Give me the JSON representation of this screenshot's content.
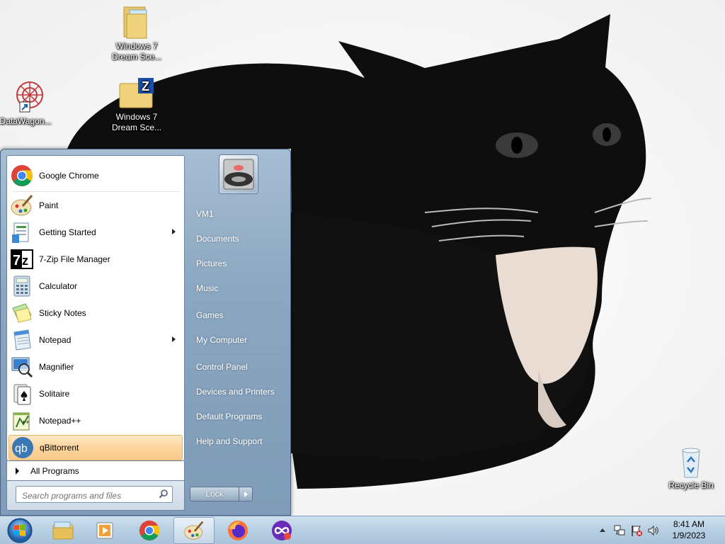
{
  "desktop": {
    "icons": [
      {
        "label_line1": "Windows 7",
        "label_line2": "Dream Sce..."
      },
      {
        "label_line1": "Windows 7",
        "label_line2": "Dream Sce..."
      },
      {
        "label_line1": "DataWagon...",
        "label_line2": ""
      },
      {
        "label_line1": "Recycle Bin",
        "label_line2": ""
      }
    ]
  },
  "start_menu": {
    "pinned": [
      {
        "label": "Google Chrome",
        "icon": "chrome-icon"
      }
    ],
    "programs": [
      {
        "label": "Paint",
        "icon": "paint-icon",
        "submenu": false
      },
      {
        "label": "Getting Started",
        "icon": "getting-started-icon",
        "submenu": true
      },
      {
        "label": "7-Zip File Manager",
        "icon": "7zip-icon",
        "submenu": false
      },
      {
        "label": "Calculator",
        "icon": "calculator-icon",
        "submenu": false
      },
      {
        "label": "Sticky Notes",
        "icon": "sticky-notes-icon",
        "submenu": false
      },
      {
        "label": "Notepad",
        "icon": "notepad-icon",
        "submenu": true
      },
      {
        "label": "Magnifier",
        "icon": "magnifier-icon",
        "submenu": false
      },
      {
        "label": "Solitaire",
        "icon": "solitaire-icon",
        "submenu": false
      },
      {
        "label": "Notepad++",
        "icon": "notepadpp-icon",
        "submenu": false
      },
      {
        "label": "qBittorrent",
        "icon": "qbittorrent-icon",
        "submenu": false,
        "highlighted": true
      }
    ],
    "all_programs": "All Programs",
    "search_placeholder": "Search programs and files",
    "right_links": [
      {
        "label": "VM1"
      },
      {
        "label": "Documents"
      },
      {
        "label": "Pictures"
      },
      {
        "label": "Music"
      },
      {
        "label": "Games"
      },
      {
        "label": "My Computer"
      },
      {
        "label": "Control Panel"
      },
      {
        "label": "Devices and Printers"
      },
      {
        "label": "Default Programs"
      },
      {
        "label": "Help and Support"
      }
    ],
    "lock_label": "Lock"
  },
  "taskbar": {
    "apps": [
      "explorer-icon",
      "media-player-icon",
      "chrome-icon",
      "paint-icon",
      "firefox-icon",
      "app-icon"
    ],
    "clock_time": "8:41 AM",
    "clock_date": "1/9/2023"
  },
  "colors": {
    "highlight": "#fbd59c",
    "start_menu_blue": "#8aa6c0",
    "taskbar": "#b9d0e4"
  }
}
